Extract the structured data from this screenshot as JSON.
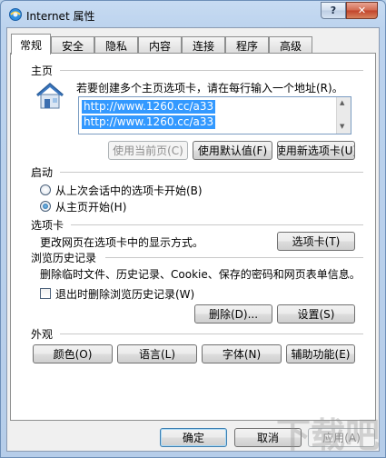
{
  "window": {
    "title": "Internet 属性",
    "help": "?",
    "close": "✕"
  },
  "tabs": [
    "常规",
    "安全",
    "隐私",
    "内容",
    "连接",
    "程序",
    "高级"
  ],
  "home": {
    "section": "主页",
    "instruction": "若要创建多个主页选项卡，请在每行输入一个地址(R)。",
    "urls": [
      "http://www.1260.cc/a33",
      "http://www.1260.cc/a33"
    ],
    "buttons": [
      "使用当前页(C)",
      "使用默认值(F)",
      "使用新选项卡(U)"
    ]
  },
  "startup": {
    "section": "启动",
    "options": [
      "从上次会话中的选项卡开始(B)",
      "从主页开始(H)"
    ],
    "selected": 1
  },
  "tabsSection": {
    "section": "选项卡",
    "desc": "更改网页在选项卡中的显示方式。",
    "button": "选项卡(T)"
  },
  "history": {
    "section": "浏览历史记录",
    "desc": "删除临时文件、历史记录、Cookie、保存的密码和网页表单信息。",
    "checkbox": "退出时删除浏览历史记录(W)",
    "delete": "删除(D)...",
    "settings": "设置(S)"
  },
  "appearance": {
    "section": "外观",
    "buttons": [
      "颜色(O)",
      "语言(L)",
      "字体(N)",
      "辅助功能(E)"
    ]
  },
  "footer": {
    "ok": "确定",
    "cancel": "取消",
    "apply": "应用(A)"
  },
  "watermark": "下载吧"
}
